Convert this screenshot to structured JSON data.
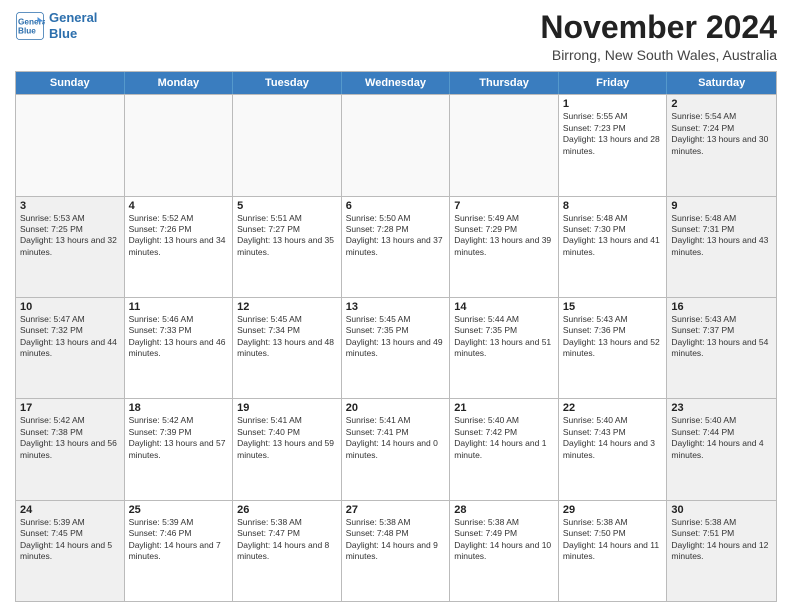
{
  "logo": {
    "line1": "General",
    "line2": "Blue"
  },
  "title": "November 2024",
  "subtitle": "Birrong, New South Wales, Australia",
  "days": [
    "Sunday",
    "Monday",
    "Tuesday",
    "Wednesday",
    "Thursday",
    "Friday",
    "Saturday"
  ],
  "rows": [
    [
      {
        "day": "",
        "info": ""
      },
      {
        "day": "",
        "info": ""
      },
      {
        "day": "",
        "info": ""
      },
      {
        "day": "",
        "info": ""
      },
      {
        "day": "",
        "info": ""
      },
      {
        "day": "1",
        "info": "Sunrise: 5:55 AM\nSunset: 7:23 PM\nDaylight: 13 hours and 28 minutes."
      },
      {
        "day": "2",
        "info": "Sunrise: 5:54 AM\nSunset: 7:24 PM\nDaylight: 13 hours and 30 minutes."
      }
    ],
    [
      {
        "day": "3",
        "info": "Sunrise: 5:53 AM\nSunset: 7:25 PM\nDaylight: 13 hours and 32 minutes."
      },
      {
        "day": "4",
        "info": "Sunrise: 5:52 AM\nSunset: 7:26 PM\nDaylight: 13 hours and 34 minutes."
      },
      {
        "day": "5",
        "info": "Sunrise: 5:51 AM\nSunset: 7:27 PM\nDaylight: 13 hours and 35 minutes."
      },
      {
        "day": "6",
        "info": "Sunrise: 5:50 AM\nSunset: 7:28 PM\nDaylight: 13 hours and 37 minutes."
      },
      {
        "day": "7",
        "info": "Sunrise: 5:49 AM\nSunset: 7:29 PM\nDaylight: 13 hours and 39 minutes."
      },
      {
        "day": "8",
        "info": "Sunrise: 5:48 AM\nSunset: 7:30 PM\nDaylight: 13 hours and 41 minutes."
      },
      {
        "day": "9",
        "info": "Sunrise: 5:48 AM\nSunset: 7:31 PM\nDaylight: 13 hours and 43 minutes."
      }
    ],
    [
      {
        "day": "10",
        "info": "Sunrise: 5:47 AM\nSunset: 7:32 PM\nDaylight: 13 hours and 44 minutes."
      },
      {
        "day": "11",
        "info": "Sunrise: 5:46 AM\nSunset: 7:33 PM\nDaylight: 13 hours and 46 minutes."
      },
      {
        "day": "12",
        "info": "Sunrise: 5:45 AM\nSunset: 7:34 PM\nDaylight: 13 hours and 48 minutes."
      },
      {
        "day": "13",
        "info": "Sunrise: 5:45 AM\nSunset: 7:35 PM\nDaylight: 13 hours and 49 minutes."
      },
      {
        "day": "14",
        "info": "Sunrise: 5:44 AM\nSunset: 7:35 PM\nDaylight: 13 hours and 51 minutes."
      },
      {
        "day": "15",
        "info": "Sunrise: 5:43 AM\nSunset: 7:36 PM\nDaylight: 13 hours and 52 minutes."
      },
      {
        "day": "16",
        "info": "Sunrise: 5:43 AM\nSunset: 7:37 PM\nDaylight: 13 hours and 54 minutes."
      }
    ],
    [
      {
        "day": "17",
        "info": "Sunrise: 5:42 AM\nSunset: 7:38 PM\nDaylight: 13 hours and 56 minutes."
      },
      {
        "day": "18",
        "info": "Sunrise: 5:42 AM\nSunset: 7:39 PM\nDaylight: 13 hours and 57 minutes."
      },
      {
        "day": "19",
        "info": "Sunrise: 5:41 AM\nSunset: 7:40 PM\nDaylight: 13 hours and 59 minutes."
      },
      {
        "day": "20",
        "info": "Sunrise: 5:41 AM\nSunset: 7:41 PM\nDaylight: 14 hours and 0 minutes."
      },
      {
        "day": "21",
        "info": "Sunrise: 5:40 AM\nSunset: 7:42 PM\nDaylight: 14 hours and 1 minute."
      },
      {
        "day": "22",
        "info": "Sunrise: 5:40 AM\nSunset: 7:43 PM\nDaylight: 14 hours and 3 minutes."
      },
      {
        "day": "23",
        "info": "Sunrise: 5:40 AM\nSunset: 7:44 PM\nDaylight: 14 hours and 4 minutes."
      }
    ],
    [
      {
        "day": "24",
        "info": "Sunrise: 5:39 AM\nSunset: 7:45 PM\nDaylight: 14 hours and 5 minutes."
      },
      {
        "day": "25",
        "info": "Sunrise: 5:39 AM\nSunset: 7:46 PM\nDaylight: 14 hours and 7 minutes."
      },
      {
        "day": "26",
        "info": "Sunrise: 5:38 AM\nSunset: 7:47 PM\nDaylight: 14 hours and 8 minutes."
      },
      {
        "day": "27",
        "info": "Sunrise: 5:38 AM\nSunset: 7:48 PM\nDaylight: 14 hours and 9 minutes."
      },
      {
        "day": "28",
        "info": "Sunrise: 5:38 AM\nSunset: 7:49 PM\nDaylight: 14 hours and 10 minutes."
      },
      {
        "day": "29",
        "info": "Sunrise: 5:38 AM\nSunset: 7:50 PM\nDaylight: 14 hours and 11 minutes."
      },
      {
        "day": "30",
        "info": "Sunrise: 5:38 AM\nSunset: 7:51 PM\nDaylight: 14 hours and 12 minutes."
      }
    ]
  ]
}
